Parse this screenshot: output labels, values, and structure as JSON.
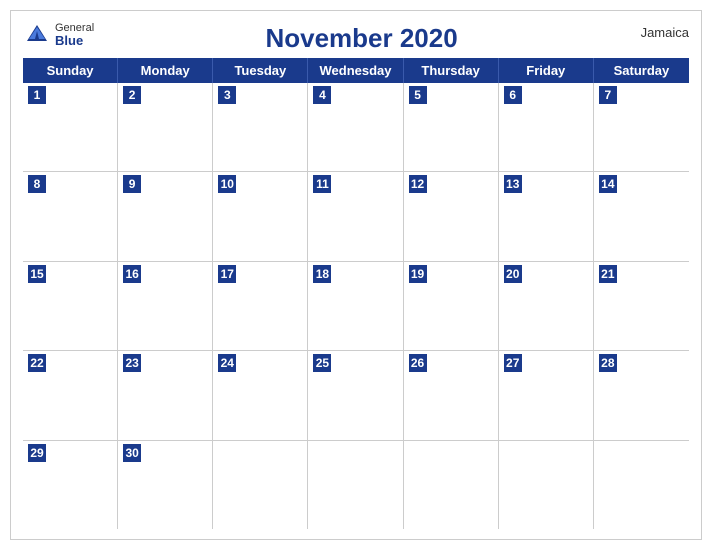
{
  "header": {
    "logo_general": "General",
    "logo_blue": "Blue",
    "title": "November 2020",
    "country": "Jamaica"
  },
  "day_headers": [
    "Sunday",
    "Monday",
    "Tuesday",
    "Wednesday",
    "Thursday",
    "Friday",
    "Saturday"
  ],
  "weeks": [
    [
      {
        "num": "1",
        "empty": false
      },
      {
        "num": "2",
        "empty": false
      },
      {
        "num": "3",
        "empty": false
      },
      {
        "num": "4",
        "empty": false
      },
      {
        "num": "5",
        "empty": false
      },
      {
        "num": "6",
        "empty": false
      },
      {
        "num": "7",
        "empty": false
      }
    ],
    [
      {
        "num": "8",
        "empty": false
      },
      {
        "num": "9",
        "empty": false
      },
      {
        "num": "10",
        "empty": false
      },
      {
        "num": "11",
        "empty": false
      },
      {
        "num": "12",
        "empty": false
      },
      {
        "num": "13",
        "empty": false
      },
      {
        "num": "14",
        "empty": false
      }
    ],
    [
      {
        "num": "15",
        "empty": false
      },
      {
        "num": "16",
        "empty": false
      },
      {
        "num": "17",
        "empty": false
      },
      {
        "num": "18",
        "empty": false
      },
      {
        "num": "19",
        "empty": false
      },
      {
        "num": "20",
        "empty": false
      },
      {
        "num": "21",
        "empty": false
      }
    ],
    [
      {
        "num": "22",
        "empty": false
      },
      {
        "num": "23",
        "empty": false
      },
      {
        "num": "24",
        "empty": false
      },
      {
        "num": "25",
        "empty": false
      },
      {
        "num": "26",
        "empty": false
      },
      {
        "num": "27",
        "empty": false
      },
      {
        "num": "28",
        "empty": false
      }
    ],
    [
      {
        "num": "29",
        "empty": false
      },
      {
        "num": "30",
        "empty": false
      },
      {
        "num": "",
        "empty": true
      },
      {
        "num": "",
        "empty": true
      },
      {
        "num": "",
        "empty": true
      },
      {
        "num": "",
        "empty": true
      },
      {
        "num": "",
        "empty": true
      }
    ]
  ]
}
